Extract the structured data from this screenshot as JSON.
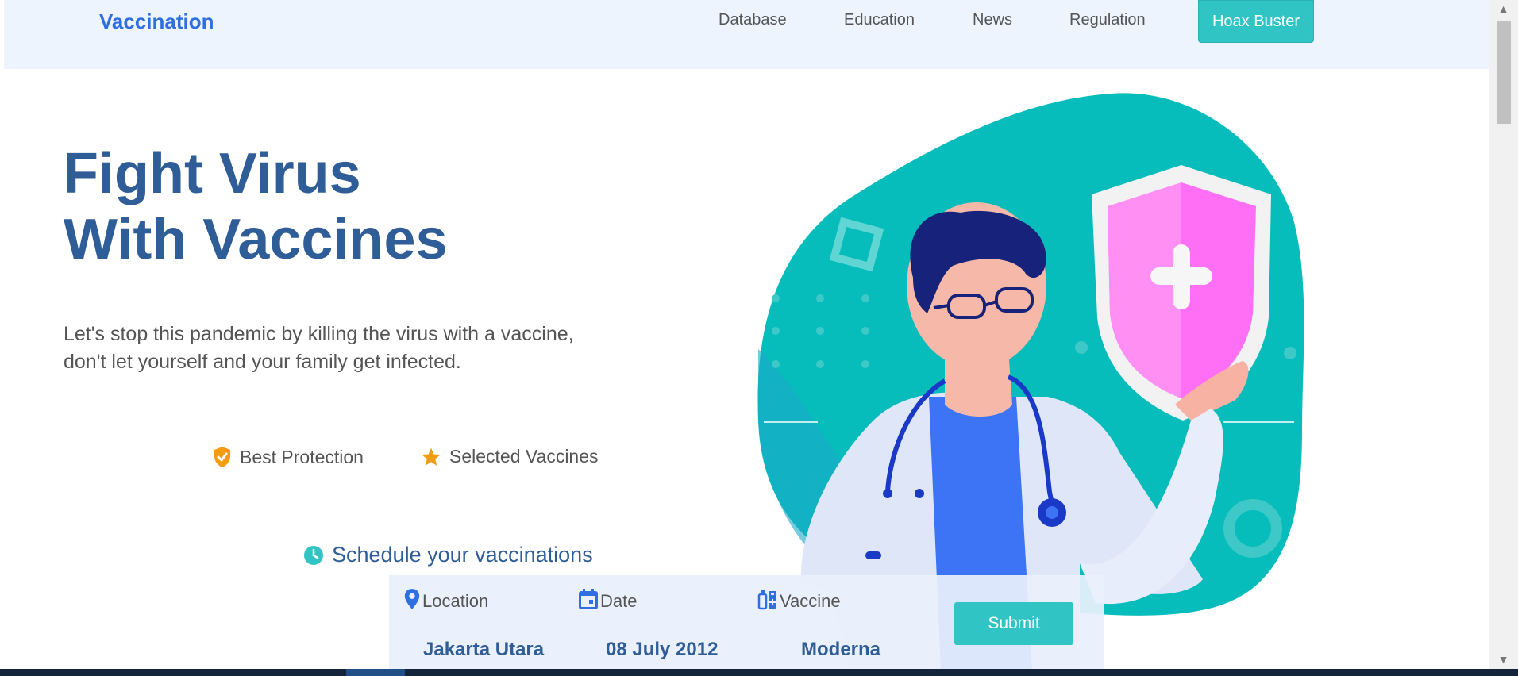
{
  "nav": {
    "brand": "Vaccination",
    "links": [
      "Database",
      "Education",
      "News",
      "Regulation"
    ],
    "cta": "Hoax Buster"
  },
  "hero": {
    "title_line1": "Fight Virus",
    "title_line2": "With Vaccines",
    "subtitle_line1": "Let's stop this pandemic by killing the virus with a vaccine,",
    "subtitle_line2": "don't let yourself and your family get infected."
  },
  "features": [
    {
      "label": "Best Protection",
      "icon": "shield-check-icon"
    },
    {
      "label": "Selected Vaccines",
      "icon": "star-icon"
    }
  ],
  "schedule": {
    "label": "Schedule your vaccinations",
    "icon": "clock-icon"
  },
  "form": {
    "location_label": "Location",
    "date_label": "Date",
    "vaccine_label": "Vaccine",
    "location_value": "Jakarta Utara",
    "date_value": "08 July 2012",
    "vaccine_value": "Moderna",
    "submit": "Submit"
  },
  "colors": {
    "brand": "#2f6fe0",
    "accent": "#31c4c4",
    "heading": "#2f5d97",
    "orange": "#f39c12"
  }
}
